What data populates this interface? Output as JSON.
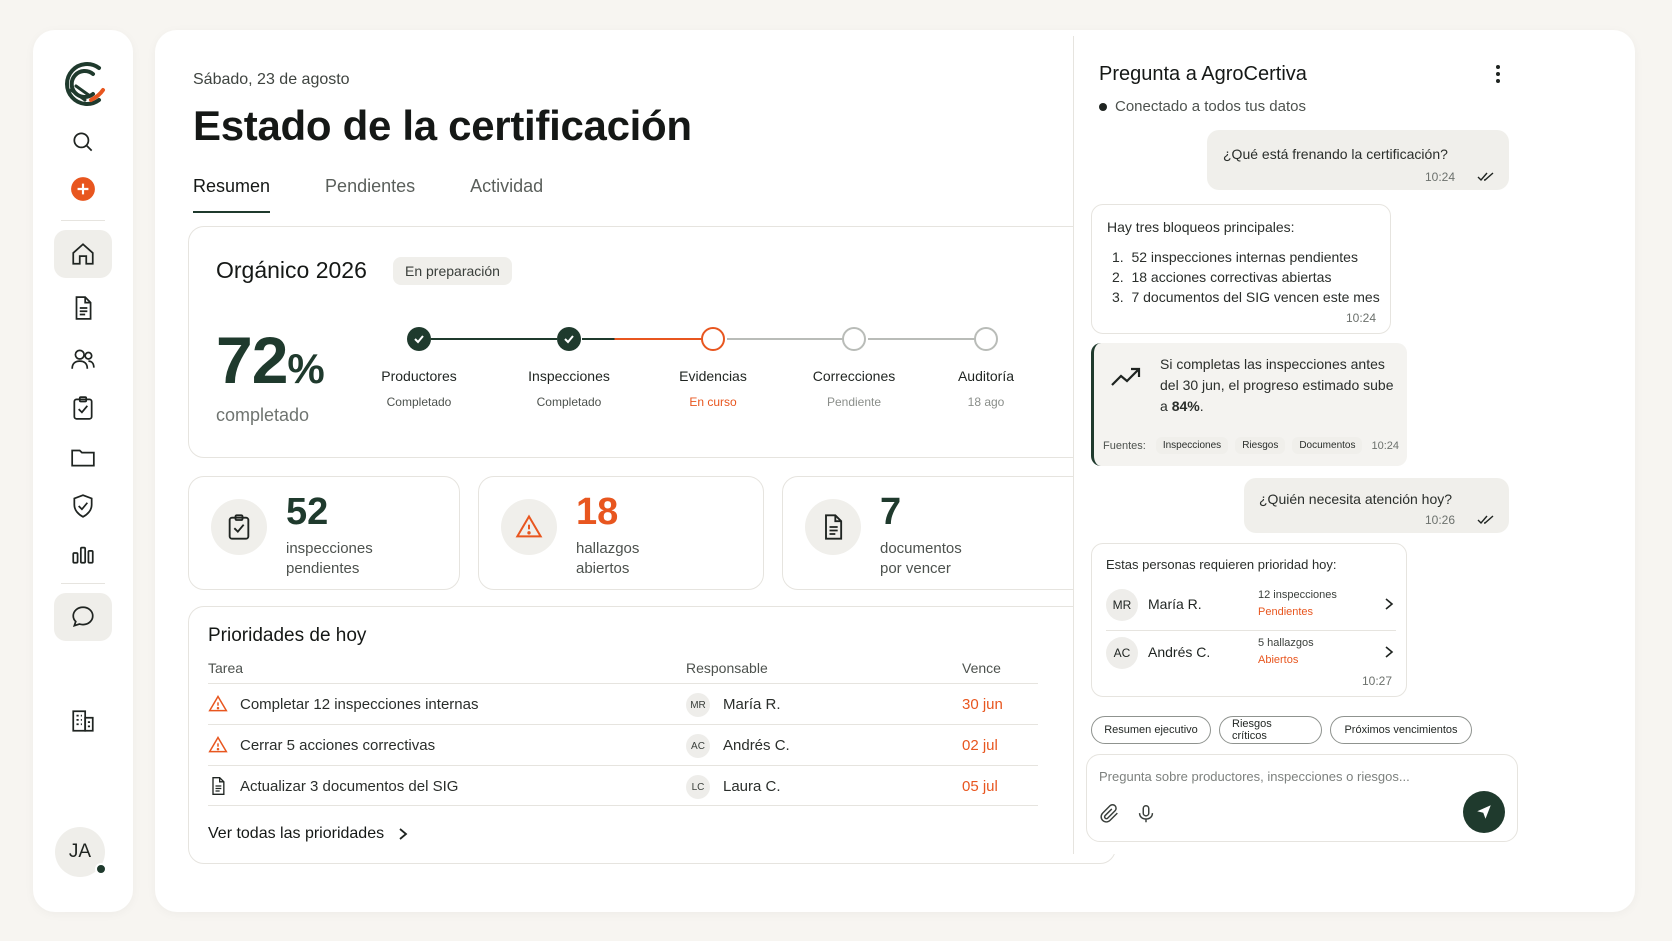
{
  "sidebar": {
    "items": [
      "logo",
      "search",
      "add",
      "home",
      "documents",
      "users",
      "checklist",
      "folder",
      "shield",
      "analytics",
      "chat",
      "building"
    ],
    "active": "home",
    "avatar_initials": "JA"
  },
  "header": {
    "date": "Sábado, 23 de agosto",
    "title": "Estado de la certificación",
    "tabs": [
      {
        "label": "Resumen",
        "active": true
      },
      {
        "label": "Pendientes",
        "active": false
      },
      {
        "label": "Actividad",
        "active": false
      }
    ]
  },
  "certification": {
    "name": "Orgánico 2026",
    "status_badge": "En preparación",
    "percent": "72",
    "percent_symbol": "%",
    "percent_label": "completado",
    "steps": [
      {
        "name": "Productores",
        "status": "Completado",
        "state": "done"
      },
      {
        "name": "Inspecciones",
        "status": "Completado",
        "state": "done"
      },
      {
        "name": "Evidencias",
        "status": "En curso",
        "state": "current"
      },
      {
        "name": "Correcciones",
        "status": "Pendiente",
        "state": "pending"
      },
      {
        "name": "Auditoría",
        "status": "18 ago",
        "state": "pending"
      }
    ]
  },
  "stats": [
    {
      "value": "52",
      "label": "inspecciones pendientes",
      "icon": "clipboard-check-icon"
    },
    {
      "value": "18",
      "label": "hallazgos abiertos",
      "icon": "warning-icon"
    },
    {
      "value": "7",
      "label": "documentos por vencer",
      "icon": "document-icon"
    }
  ],
  "priorities": {
    "title": "Prioridades de hoy",
    "columns": [
      "Tarea",
      "Responsable",
      "Vence"
    ],
    "rows": [
      {
        "task": "Completar 12 inspecciones internas",
        "initials": "MR",
        "owner": "María R.",
        "due": "30 jun",
        "icon": "warning-icon"
      },
      {
        "task": "Cerrar 5 acciones correctivas",
        "initials": "AC",
        "owner": "Andrés C.",
        "due": "02 jul",
        "icon": "warning-icon"
      },
      {
        "task": "Actualizar 3 documentos del SIG",
        "initials": "LC",
        "owner": "Laura C.",
        "due": "05 jul",
        "icon": "document-icon"
      }
    ],
    "see_all": "Ver todas las prioridades"
  },
  "chat": {
    "title": "Pregunta a AgroCertiva",
    "status": "Conectado a todos tus datos",
    "msg1": {
      "text": "¿Qué está frenando la certificación?",
      "time": "10:24"
    },
    "msg2": {
      "intro": "Hay tres bloqueos principales:",
      "items": [
        "52 inspecciones internas pendientes",
        "18 acciones correctivas abiertas",
        "7 documentos del SIG vencen este mes"
      ],
      "time": "10:24"
    },
    "msg3": {
      "text_pre": "Si completas las inspecciones antes del 30 jun, el progreso estimado sube a ",
      "text_bold": "84%",
      "text_post": ".",
      "sources_label": "Fuentes:",
      "sources": [
        "Inspecciones",
        "Riesgos",
        "Documentos"
      ],
      "time": "10:24"
    },
    "msg4": {
      "text": "¿Quién necesita atención hoy?",
      "time": "10:26"
    },
    "msg5": {
      "intro": "Estas personas requieren prioridad hoy:",
      "people": [
        {
          "initials": "MR",
          "name": "María R.",
          "info": "12 inspecciones",
          "status": "Pendientes"
        },
        {
          "initials": "AC",
          "name": "Andrés C.",
          "info": "5 hallazgos",
          "status": "Abiertos"
        }
      ],
      "time": "10:27"
    },
    "chips": [
      "Resumen ejecutivo",
      "Riesgos críticos",
      "Próximos vencimientos"
    ],
    "placeholder": "Pregunta sobre productores, inspecciones o riesgos..."
  },
  "colors": {
    "accent": "#e8561f",
    "brand": "#1f3a2d"
  }
}
